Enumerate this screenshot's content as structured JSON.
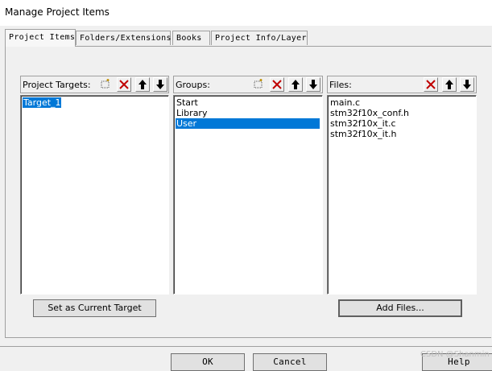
{
  "window": {
    "title": "Manage Project Items"
  },
  "tabs": [
    {
      "label": "Project Items",
      "active": true
    },
    {
      "label": "Folders/Extensions",
      "active": false
    },
    {
      "label": "Books",
      "active": false
    },
    {
      "label": "Project Info/Layer",
      "active": false
    }
  ],
  "targets": {
    "label": "Project Targets:",
    "items": [
      "Target_1"
    ],
    "selected": "Target_1"
  },
  "groups": {
    "label": "Groups:",
    "items": [
      "Start",
      "Library",
      "User"
    ],
    "selected": "User"
  },
  "files": {
    "label": "Files:",
    "items": [
      "main.c",
      "stm32f10x_conf.h",
      "stm32f10x_it.c",
      "stm32f10x_it.h"
    ]
  },
  "buttons": {
    "set_current_target": "Set as Current Target",
    "add_files": "Add Files...",
    "ok": "OK",
    "cancel": "Cancel",
    "help": "Help"
  },
  "watermark": "CSDN @Shanmin",
  "icons": {
    "new": "new-item-icon",
    "delete": "delete-icon",
    "move_up": "move-up-icon",
    "move_down": "move-down-icon"
  },
  "colors": {
    "selection": "#0078d7",
    "delete_red": "#c00000"
  }
}
